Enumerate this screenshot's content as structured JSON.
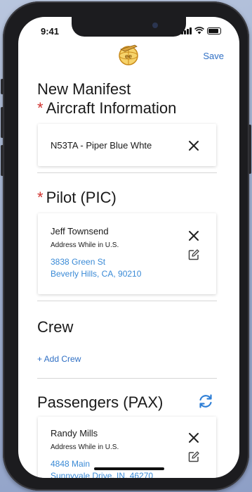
{
  "status": {
    "time": "9:41"
  },
  "header": {
    "save_label": "Save"
  },
  "page_title": "New Manifest",
  "aircraft": {
    "title": "Aircraft Information",
    "required_mark": "*",
    "value": "N53TA - Piper Blue Whte"
  },
  "pilot": {
    "title": "Pilot (PIC)",
    "required_mark": "*",
    "name": "Jeff Townsend",
    "address_label": "Address While in U.S.",
    "address_line1": "3838 Green St",
    "address_line2": "Beverly Hills, CA, 90210"
  },
  "crew": {
    "title": "Crew",
    "add_label": "+ Add Crew"
  },
  "passengers": {
    "title": "Passengers (PAX)",
    "items": [
      {
        "name": "Randy Mills",
        "address_label": "Address While in U.S.",
        "address_line1": "4848 Main",
        "address_line2": "Sunnyvale Drive, IN, 46270"
      }
    ]
  },
  "colors": {
    "accent": "#2f6fc4",
    "link": "#3a8ad6",
    "required": "#d0312d"
  },
  "icons": [
    "close-icon",
    "edit-icon",
    "refresh-icon",
    "logo-icon"
  ]
}
